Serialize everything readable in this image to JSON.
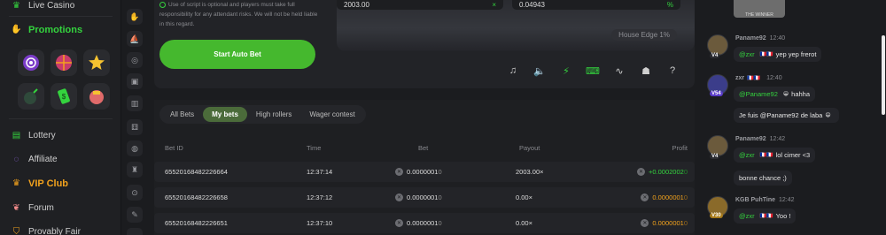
{
  "sidebar": {
    "live_casino": "Live Casino",
    "promotions": "Promotions",
    "lottery": "Lottery",
    "affiliate": "Affiliate",
    "vip_club": "VIP Club",
    "forum": "Forum",
    "provably_fair": "Provably Fair"
  },
  "game": {
    "notice_text": "Use of script is optional and players must take full responsibility for any attendant risks. We will not be held liable in this regard.",
    "start_auto_bet": "Start Auto Bet",
    "input_left_value": "2003.00",
    "input_right_value": "0.04943",
    "input_right_suffix": "%",
    "input_left_suffix": "×",
    "house_edge": "House Edge 1%"
  },
  "bets": {
    "tabs": [
      "All Bets",
      "My bets",
      "High rollers",
      "Wager contest"
    ],
    "active_tab": 1,
    "columns": [
      "Bet ID",
      "Time",
      "Bet",
      "Payout",
      "Profit"
    ],
    "rows": [
      {
        "id": "65520168482226664",
        "time": "12:37:14",
        "bet": "0.0000001",
        "bet_tail": "0",
        "payout": "2003.00×",
        "profit": "+0.0002002",
        "profit_tail": "0",
        "win": true
      },
      {
        "id": "65520168482226658",
        "time": "12:37:12",
        "bet": "0.0000001",
        "bet_tail": "0",
        "payout": "0.00×",
        "profit": "0.0000001",
        "profit_tail": "0",
        "win": false
      },
      {
        "id": "65520168482226651",
        "time": "12:37:10",
        "bet": "0.0000001",
        "bet_tail": "0",
        "payout": "0.00×",
        "profit": "0.0000001",
        "profit_tail": "0",
        "win": false
      }
    ]
  },
  "chat": {
    "stream_caption": "THE WINNER",
    "messages": [
      {
        "user": "Paname92",
        "time": "12:40",
        "level": "V4",
        "lines": [
          {
            "mention": "@zxr",
            "text": "yep yep frerot"
          }
        ]
      },
      {
        "user": "zxr",
        "time": "12:40",
        "level": "V54",
        "lines": [
          {
            "mention": "@Paname92",
            "text": "hahha"
          },
          {
            "mention": "",
            "text": "Je fuis @Paname92 de laba"
          }
        ]
      },
      {
        "user": "Paname92",
        "time": "12:42",
        "level": "V4",
        "lines": [
          {
            "mention": "@zxr",
            "text": "lol cimer <3"
          },
          {
            "mention": "",
            "text": "bonne chance ;)"
          }
        ]
      },
      {
        "user": "KGB PuhTine",
        "time": "12:42",
        "level": "V30",
        "lines": [
          {
            "mention": "@zxr",
            "text": "Yoo !"
          }
        ]
      }
    ]
  },
  "colors": {
    "accent_green": "#34d33e",
    "vip_orange": "#f2a21d",
    "background": "#1b1c1f"
  }
}
